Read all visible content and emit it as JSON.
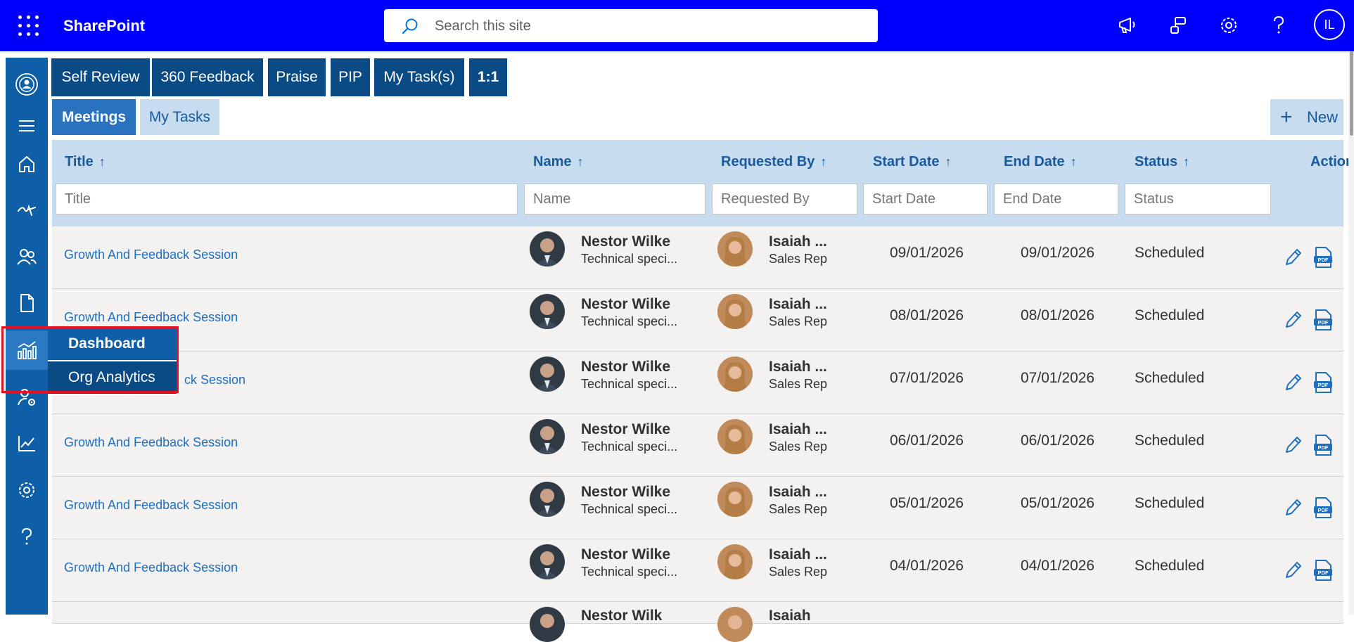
{
  "suite": {
    "brand": "SharePoint",
    "search_placeholder": "Search this site",
    "user_initials": "IL"
  },
  "colors": {
    "suitebar": "#0000ff",
    "rail": "#0f5ea8",
    "tab_dark": "#0a4a85",
    "tab_active": "#2872c0",
    "tab_light": "#c7dcef",
    "link": "#1f6fbf",
    "highlight": "#e81123"
  },
  "rail_icons": [
    "profile-icon",
    "hamburger-icon",
    "home-icon",
    "signature-icon",
    "people-icon",
    "document-icon",
    "analytics-icon",
    "user-settings-icon",
    "chart-line-icon",
    "gear-icon",
    "help-icon"
  ],
  "flyout": {
    "items": [
      "Dashboard",
      "Org Analytics"
    ]
  },
  "top_tabs": [
    "Self Review",
    "360 Feedback",
    "Praise",
    "PIP",
    "My Task(s)",
    "1:1"
  ],
  "sub_tabs": [
    "Meetings",
    "My Tasks"
  ],
  "new_button": "New",
  "columns": {
    "title": "Title",
    "name": "Name",
    "requested_by": "Requested By",
    "start_date": "Start Date",
    "end_date": "End Date",
    "status": "Status",
    "action": "Action"
  },
  "sort_arrow": "↑",
  "filters": {
    "title": "Title",
    "name": "Name",
    "requested_by": "Requested By",
    "start_date": "Start Date",
    "end_date": "End Date",
    "status": "Status"
  },
  "rows": [
    {
      "title": "Growth And Feedback Session",
      "name": "Nestor Wilke",
      "name_role": "Technical speci...",
      "req": "Isaiah ...",
      "req_role": "Sales Rep",
      "start": "09/01/2026",
      "end": "09/01/2026",
      "status": "Scheduled"
    },
    {
      "title": "Growth And Feedback Session",
      "name": "Nestor Wilke",
      "name_role": "Technical speci...",
      "req": "Isaiah ...",
      "req_role": "Sales Rep",
      "start": "08/01/2026",
      "end": "08/01/2026",
      "status": "Scheduled"
    },
    {
      "title": "ck Session",
      "name": "Nestor Wilke",
      "name_role": "Technical speci...",
      "req": "Isaiah ...",
      "req_role": "Sales Rep",
      "start": "07/01/2026",
      "end": "07/01/2026",
      "status": "Scheduled"
    },
    {
      "title": "Growth And Feedback Session",
      "name": "Nestor Wilke",
      "name_role": "Technical speci...",
      "req": "Isaiah ...",
      "req_role": "Sales Rep",
      "start": "06/01/2026",
      "end": "06/01/2026",
      "status": "Scheduled"
    },
    {
      "title": "Growth And Feedback Session",
      "name": "Nestor Wilke",
      "name_role": "Technical speci...",
      "req": "Isaiah ...",
      "req_role": "Sales Rep",
      "start": "05/01/2026",
      "end": "05/01/2026",
      "status": "Scheduled"
    },
    {
      "title": "Growth And Feedback Session",
      "name": "Nestor Wilke",
      "name_role": "Technical speci...",
      "req": "Isaiah ...",
      "req_role": "Sales Rep",
      "start": "04/01/2026",
      "end": "04/01/2026",
      "status": "Scheduled"
    }
  ],
  "partial_row": {
    "name": "Nestor Wilk",
    "req": "Isaiah"
  }
}
